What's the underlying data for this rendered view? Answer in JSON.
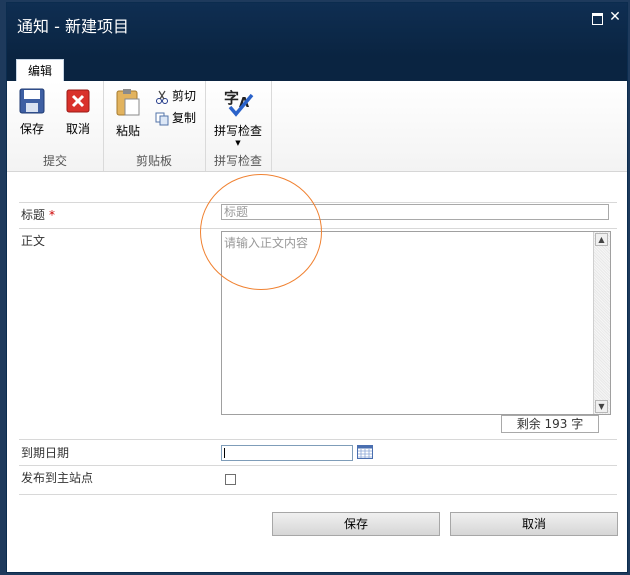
{
  "dialog": {
    "title": "通知 - 新建项目"
  },
  "tabs": [
    {
      "label": "编辑"
    }
  ],
  "ribbon": {
    "groups": [
      {
        "label": "提交",
        "buttons": [
          {
            "label": "保存",
            "icon": "save-icon"
          },
          {
            "label": "取消",
            "icon": "cancel-icon"
          }
        ]
      },
      {
        "label": "剪贴板",
        "buttons": [
          {
            "label": "粘贴",
            "icon": "paste-icon"
          },
          {
            "label": "剪切",
            "icon": "cut-icon"
          },
          {
            "label": "复制",
            "icon": "copy-icon"
          }
        ]
      },
      {
        "label": "拼写检查",
        "buttons": [
          {
            "label": "拼写检查",
            "icon": "spellcheck-icon"
          }
        ]
      }
    ]
  },
  "form": {
    "title_label": "标题",
    "required_mark": "*",
    "title_placeholder": "标题",
    "body_label": "正文",
    "body_placeholder": "请输入正文内容",
    "remaining_text": "剩余 193 字",
    "due_date_label": "到期日期",
    "publish_label": "发布到主站点",
    "publish_checked": false
  },
  "footer": {
    "save_label": "保存",
    "cancel_label": "取消"
  },
  "colors": {
    "titlebar": "#0f2e52",
    "annotation_circle": "#f08232",
    "required": "#cc0000"
  },
  "annotation": "orange-circle-highlight"
}
